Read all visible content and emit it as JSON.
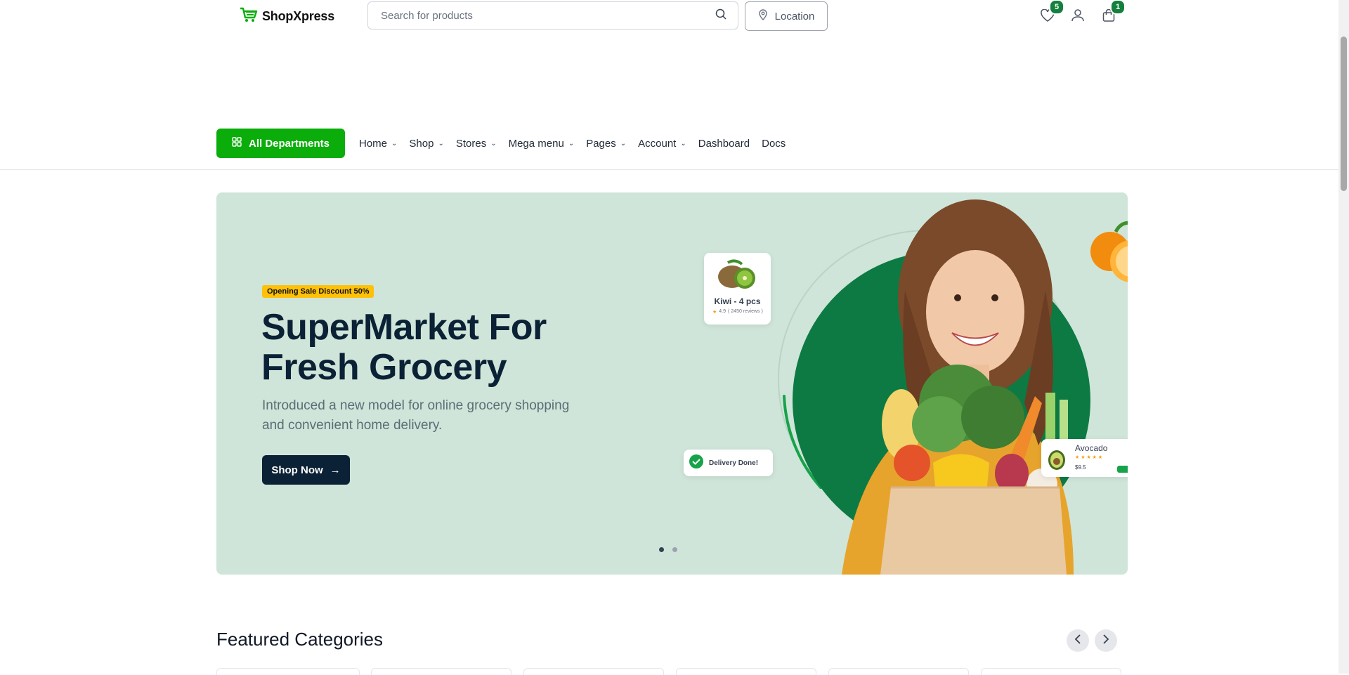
{
  "header": {
    "logo_text": "ShopXpress",
    "search_placeholder": "Search for products",
    "location_label": "Location",
    "wishlist_count": "5",
    "cart_count": "1"
  },
  "nav": {
    "departments_label": "All Departments",
    "items": [
      "Home",
      "Shop",
      "Stores",
      "Mega menu",
      "Pages",
      "Account",
      "Dashboard",
      "Docs"
    ]
  },
  "hero": {
    "tag": "Opening Sale Discount 50%",
    "title_line1": "SuperMarket For",
    "title_line2": "Fresh Grocery",
    "subtitle": "Introduced a new model for online grocery shopping and convenient home delivery.",
    "button_label": "Shop Now",
    "kiwi_card": {
      "name": "Kiwi - 4 pcs",
      "rating": "4.9",
      "reviews": "( 2450 reviews )"
    },
    "delivery_label": "Delivery Done!",
    "avocado_card": {
      "name": "Avocado",
      "price": "$9.5"
    },
    "slide_count": 2,
    "active_slide": 1
  },
  "featured": {
    "title": "Featured Categories"
  },
  "colors": {
    "brand_green": "#0aad0a",
    "dark_navy": "#0b2135",
    "hero_bg": "#cfe5d9",
    "tag_yellow": "#ffc107",
    "badge_green": "#15803d"
  }
}
